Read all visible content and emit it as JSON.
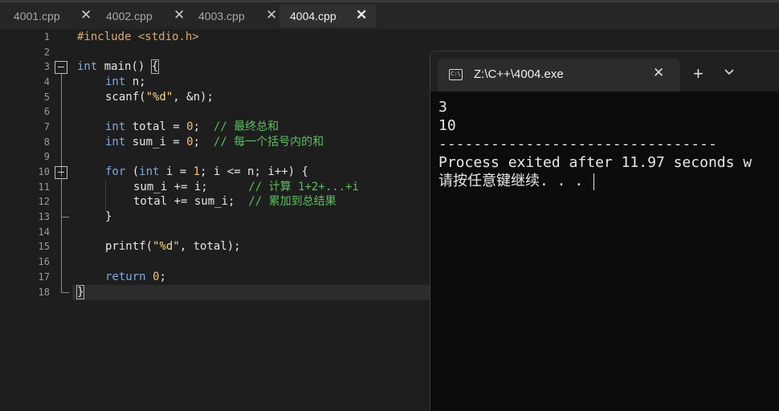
{
  "tabs": [
    {
      "name": "4001.cpp",
      "active": false
    },
    {
      "name": "4002.cpp",
      "active": false
    },
    {
      "name": "4003.cpp",
      "active": false
    },
    {
      "name": "4004.cpp",
      "active": true
    }
  ],
  "tab_close_glyph": "✕",
  "editor": {
    "line_numbers": [
      "1",
      "2",
      "3",
      "4",
      "5",
      "6",
      "7",
      "8",
      "9",
      "10",
      "11",
      "12",
      "13",
      "14",
      "15",
      "16",
      "17",
      "18"
    ],
    "code": {
      "l1_pp": "#include <stdio.h>",
      "l3_kw": "int",
      "l3_rest": " main() ",
      "l3_brace": "{",
      "l4_kw": "int",
      "l4_rest": " n;",
      "l5_a": "scanf(",
      "l5_str": "\"%d\"",
      "l5_b": ", &n);",
      "l7_kw": "int",
      "l7_a": " total = ",
      "l7_num": "0",
      "l7_b": ";  ",
      "l7_cmt": "// 最终总和",
      "l8_kw": "int",
      "l8_a": " sum_i = ",
      "l8_num": "0",
      "l8_b": ";  ",
      "l8_cmt": "// 每一个括号内的和",
      "l10_kw1": "for",
      "l10_a": " (",
      "l10_kw2": "int",
      "l10_b": " i = ",
      "l10_num": "1",
      "l10_c": "; i <= n; i++) {",
      "l11_a": "sum_i += i;      ",
      "l11_cmt": "// 计算 1+2+...+i",
      "l12_a": "total += sum_i;  ",
      "l12_cmt": "// 累加到总结果",
      "l13": "}",
      "l15_a": "printf(",
      "l15_str": "\"%d\"",
      "l15_b": ", total);",
      "l17_kw": "return",
      "l17_sp": " ",
      "l17_num": "0",
      "l17_b": ";",
      "l18_brace": "}"
    }
  },
  "terminal": {
    "title": "Z:\\C++\\4004.exe",
    "icon_text": "C:\\",
    "close_glyph": "✕",
    "new_tab_glyph": "+",
    "output": {
      "line1": "3",
      "line2": "10",
      "line3": "--------------------------------",
      "line4": "Process exited after 11.97 seconds w",
      "line5": "请按任意键继续. . . "
    }
  },
  "colors": {
    "editor_bg": "#1e1e1e",
    "keyword": "#7aa8e6",
    "number": "#f3c16e",
    "comment": "#57c25b",
    "terminal_bg": "#0c0c0c"
  }
}
